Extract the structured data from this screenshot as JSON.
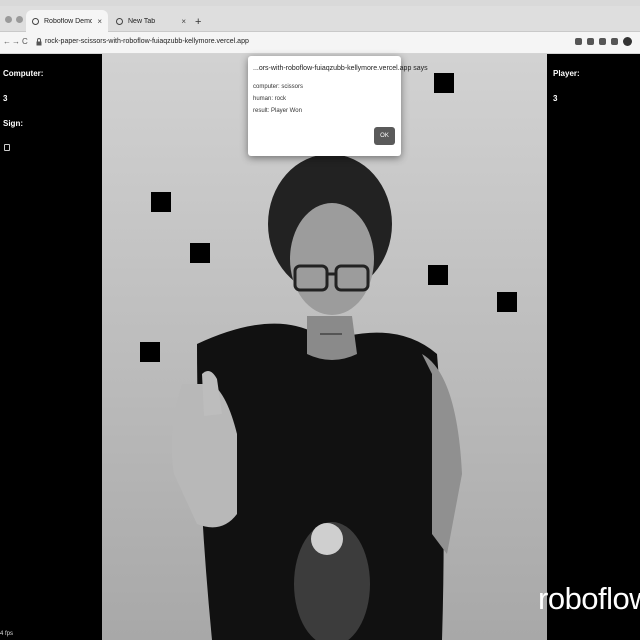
{
  "browser": {
    "tabs": [
      {
        "title": "Roboflow Demo",
        "active": true
      },
      {
        "title": "New Tab",
        "active": false
      }
    ],
    "new_tab_symbol": "+",
    "close_symbol": "×",
    "url": "rock-paper-scissors-with-roboflow-fuiaqzubb-kellymore.vercel.app",
    "nav_back": "←",
    "nav_forward": "→",
    "nav_reload": "C"
  },
  "left_panel": {
    "computer_label": "Computer:",
    "computer_score": "3",
    "sign_label": "Sign:",
    "sign_icon": "scissors-hand-icon",
    "fps": "4 fps"
  },
  "right_panel": {
    "player_label": "Player:",
    "player_score": "3"
  },
  "dialog": {
    "title": "...ors-with-roboflow-fuiaqzubb-kellymore.vercel.app says",
    "line1": "computer: scissors",
    "line2": "human: rock",
    "line3": "result: Player Won",
    "ok_label": "OK"
  },
  "watermark": "roboflow",
  "colors": {
    "panel_bg": "#000000",
    "dialog_button": "#5a5a5a"
  }
}
